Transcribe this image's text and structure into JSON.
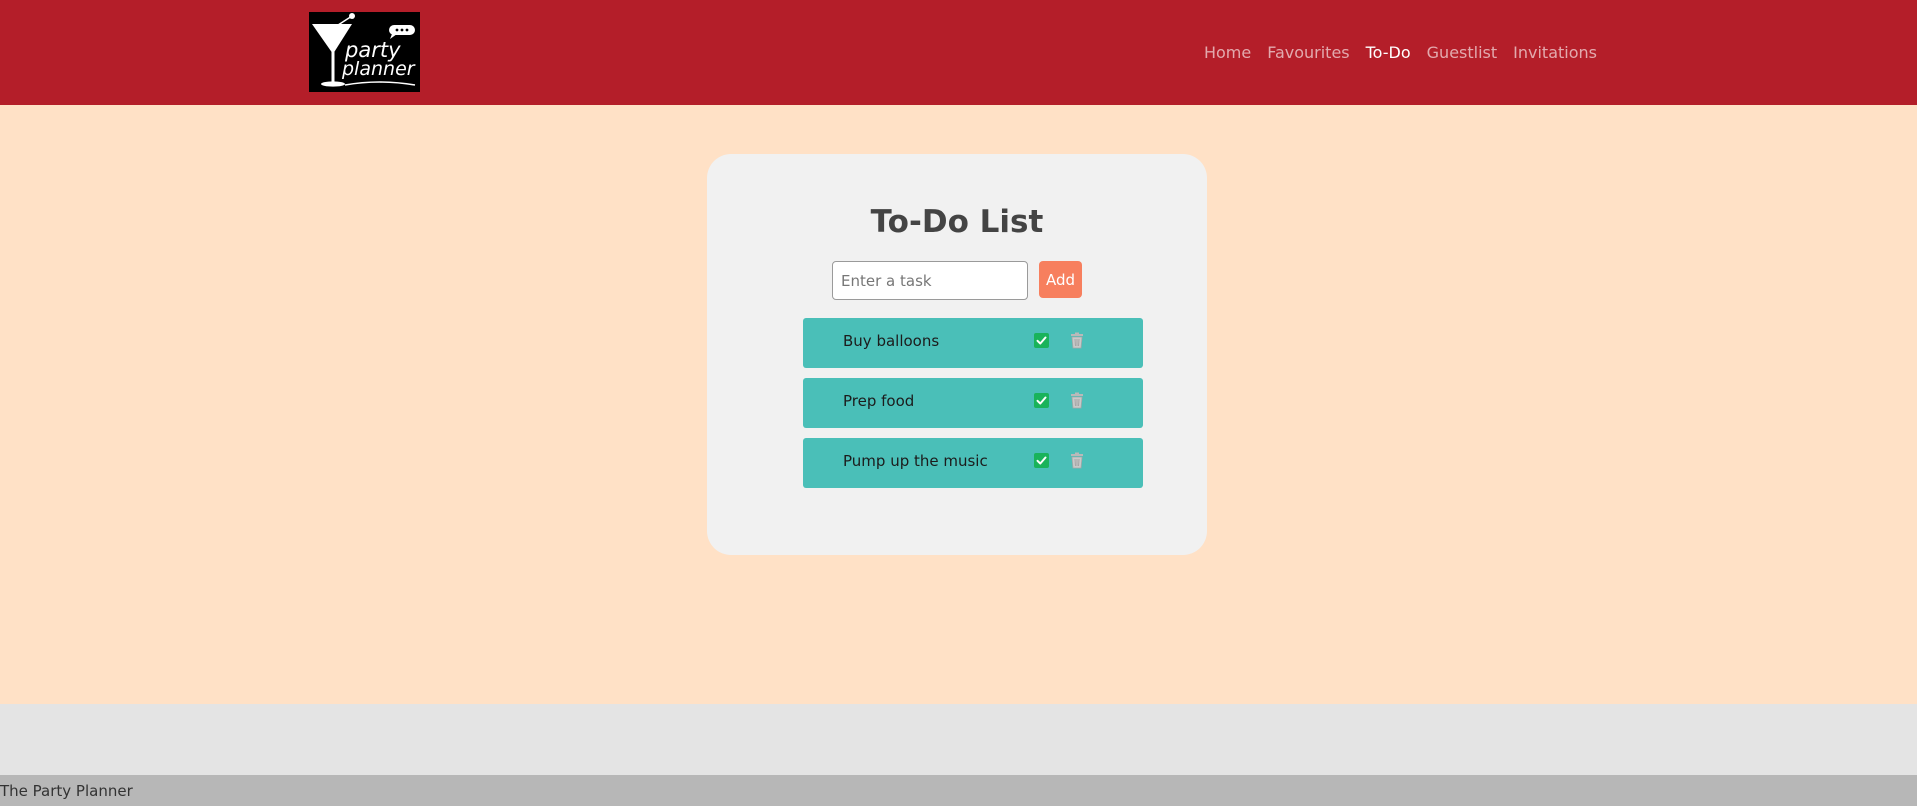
{
  "navbar": {
    "logo": {
      "text_line1": "party",
      "text_line2": "planner",
      "icon": "martini-glass-icon"
    },
    "links": [
      {
        "label": "Home",
        "active": false
      },
      {
        "label": "Favourites",
        "active": false
      },
      {
        "label": "To-Do",
        "active": true
      },
      {
        "label": "Guestlist",
        "active": false
      },
      {
        "label": "Invitations",
        "active": false
      }
    ],
    "bg_color": "#b41e29"
  },
  "main": {
    "title": "To-Do List",
    "input": {
      "placeholder": "Enter a task",
      "value": ""
    },
    "add_label": "Add",
    "add_color": "#f77f5e",
    "tasks": [
      {
        "text": "Buy balloons",
        "done_icon": "check-icon",
        "delete_icon": "trash-icon"
      },
      {
        "text": "Prep food",
        "done_icon": "check-icon",
        "delete_icon": "trash-icon"
      },
      {
        "text": "Pump up the music",
        "done_icon": "check-icon",
        "delete_icon": "trash-icon"
      }
    ],
    "task_color": "#4abfb8",
    "page_bg": "#ffe1c6"
  },
  "footer": {
    "text": "The Party Planner"
  }
}
